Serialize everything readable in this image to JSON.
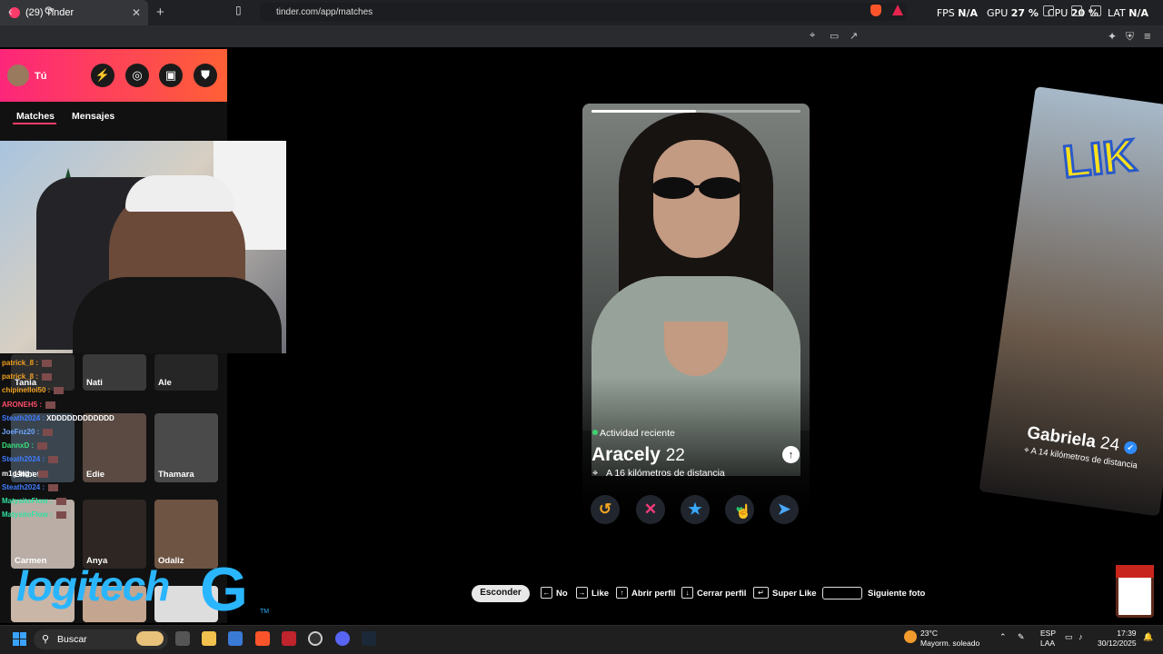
{
  "browser": {
    "tab_title": "(29) Tinder",
    "url": "tinder.com/app/matches"
  },
  "overlay": {
    "fps_label": "FPS",
    "fps_value": "N/A",
    "gpu_label": "GPU",
    "gpu_value": "27 %",
    "cpu_label": "CPU",
    "cpu_value": "20 %",
    "lat_label": "LAT",
    "lat_value": "N/A"
  },
  "sidebar": {
    "user_name": "Tú",
    "tabs": [
      "Matches",
      "Mensajes"
    ],
    "chat": [
      {
        "user": "patrick_8 :",
        "color": "#f0a020",
        "msg": ""
      },
      {
        "user": "patrick_8 :",
        "color": "#f0a020",
        "msg": ""
      },
      {
        "user": "chipinelloi50 :",
        "color": "#f0a020",
        "msg": ""
      },
      {
        "user": "ARONEH5 :",
        "color": "#ff4d6a",
        "msg": ""
      },
      {
        "user": "Steath2024 :",
        "color": "#3f7cff",
        "msg": "XDDDDDDDDDDDD"
      },
      {
        "user": "JoeFnz20 :",
        "color": "#6fa8ff",
        "msg": ""
      },
      {
        "user": "DannxD :",
        "color": "#39e07a",
        "msg": ""
      },
      {
        "user": "Steath2024 :",
        "color": "#3f7cff",
        "msg": ""
      },
      {
        "user": "m1g4ng :",
        "color": "#ffffff",
        "msg": ""
      },
      {
        "user": "Steath2024 :",
        "color": "#3f7cff",
        "msg": ""
      },
      {
        "user": "MatysitoFlow :",
        "color": "#2fe0a0",
        "msg": ""
      },
      {
        "user": "MatysitoFlow :",
        "color": "#2fe0a0",
        "msg": ""
      }
    ],
    "matches": [
      "Tania",
      "Nati",
      "Ale",
      "Lilibeth",
      "Edie",
      "Thamara",
      "Carmen",
      "Anya",
      "Odaliz"
    ]
  },
  "brand_logo": {
    "text": "logitech",
    "g": "G",
    "tm": "TM"
  },
  "profile": {
    "activity": "Actividad reciente",
    "name": "Aracely",
    "age": "22",
    "distance": "A 16 kilómetros de distancia",
    "photo_progress": 0.5
  },
  "next_profile": {
    "name": "Gabriela",
    "age": "24",
    "distance": "A 14 kilómetros de distancia",
    "banner": "LIK"
  },
  "actions": {
    "rewind": "↺",
    "nope": "✕",
    "superlike": "★",
    "like": "♥",
    "boost": "➤"
  },
  "shortcuts": {
    "hide": "Esconder",
    "no": "No",
    "like": "Like",
    "open": "Abrir perfil",
    "close": "Cerrar perfil",
    "super": "Super Like",
    "next_photo": "Siguiente foto"
  },
  "taskbar": {
    "search": "Buscar",
    "temp": "23°C",
    "weather": "Mayorm. soleado",
    "lang1": "ESP",
    "lang2": "LAA",
    "time": "17:39",
    "date": "30/12/2025"
  },
  "colors": {
    "tinder_gradient_start": "#fd267a",
    "tinder_gradient_end": "#ff6036",
    "nope": "#ff3b7a",
    "superlike": "#38a9ff",
    "rewind": "#f5a623",
    "boost": "#4aa8ff"
  }
}
